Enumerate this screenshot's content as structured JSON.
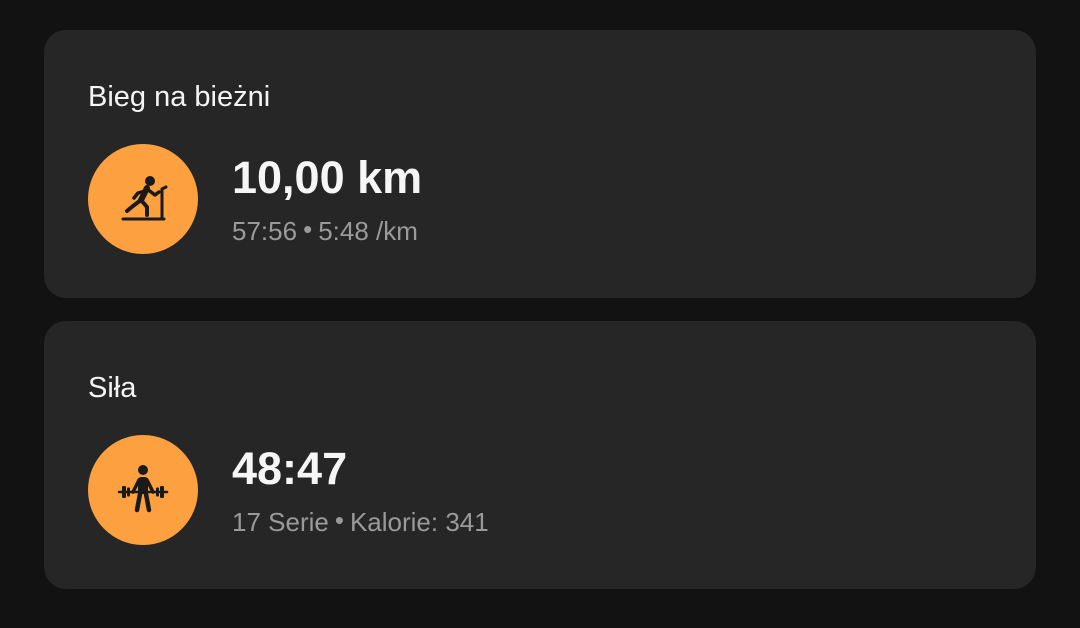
{
  "workouts": [
    {
      "title": "Bieg na bieżni",
      "icon": "treadmill-runner-icon",
      "main_value": "10,00 km",
      "details": [
        "57:56",
        "5:48 /km"
      ]
    },
    {
      "title": "Siła",
      "icon": "weightlifting-icon",
      "main_value": "48:47",
      "details": [
        "17 Serie",
        "Kalorie: 341"
      ]
    }
  ],
  "separator": "•",
  "colors": {
    "background": "#121212",
    "card": "#262626",
    "accent": "#fda03f",
    "primary_text": "#f4f4f4",
    "secondary_text": "#9a9a9a"
  }
}
